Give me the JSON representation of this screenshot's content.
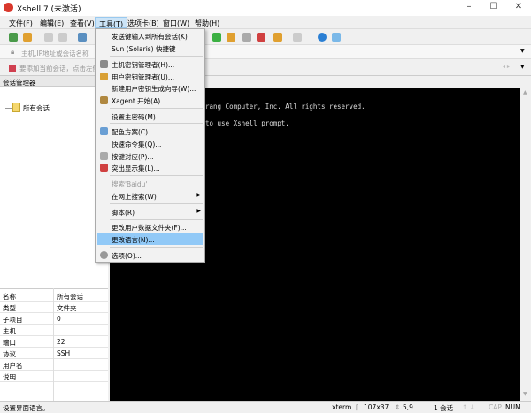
{
  "window": {
    "title": "Xshell 7 (未激活)",
    "minimize": "–",
    "maximize": "☐",
    "close": "✕"
  },
  "menubar": [
    "文件(F)",
    "编辑(E)",
    "查看(V)",
    "工具(T)",
    "选项卡(B)",
    "窗口(W)",
    "帮助(H)"
  ],
  "address_placeholder": "主机,IP地址或会话名称",
  "quickbar_text": "要添加当前会话，点击左侧",
  "session_manager": {
    "title": "会话管理器",
    "pin": "ᵖ",
    "tree_root": "所有会话"
  },
  "properties": [
    {
      "k": "名称",
      "v": "所有会话"
    },
    {
      "k": "类型",
      "v": "文件夹"
    },
    {
      "k": "子项目",
      "v": "0"
    },
    {
      "k": "主机",
      "v": ""
    },
    {
      "k": "端口",
      "v": "22"
    },
    {
      "k": "协议",
      "v": "SSH"
    },
    {
      "k": "用户名",
      "v": ""
    },
    {
      "k": "说明",
      "v": ""
    }
  ],
  "terminal": {
    "lines": [
      "rang Computer, Inc. All rights reserved.",
      "to use Xshell prompt."
    ]
  },
  "tools_menu": [
    {
      "label": "发送键输入到所有会话(K)"
    },
    {
      "label": "Sun (Solaris) 快捷键"
    },
    {
      "sep": true
    },
    {
      "label": "主机密钥管理者(H)...",
      "icon": "host-key-icon"
    },
    {
      "label": "用户密钥管理者(U)...",
      "icon": "user-key-icon"
    },
    {
      "label": "新建用户密钥生成向导(W)..."
    },
    {
      "label": "Xagent 开始(A)",
      "icon": "xagent-icon"
    },
    {
      "sep": true
    },
    {
      "label": "设置主密码(M)..."
    },
    {
      "sep": true
    },
    {
      "label": "配色方案(C)...",
      "icon": "color-scheme-icon"
    },
    {
      "label": "快速命令集(Q)..."
    },
    {
      "label": "按键对应(P)...",
      "icon": "keyboard-icon"
    },
    {
      "label": "突出显示集(L)...",
      "icon": "highlight-icon"
    },
    {
      "sep": true
    },
    {
      "label": "搜索'Baidu'",
      "disabled": true
    },
    {
      "label": "在网上搜索(W)",
      "submenu": true
    },
    {
      "sep": true
    },
    {
      "label": "脚本(R)",
      "submenu": true
    },
    {
      "sep": true
    },
    {
      "label": "更改用户数据文件夹(F)..."
    },
    {
      "label": "更改语言(N)...",
      "highlighted": true
    },
    {
      "sep": true
    },
    {
      "label": "选项(O)...",
      "icon": "gear-icon"
    }
  ],
  "statusbar": {
    "message": "设置界面语言。",
    "term": "xterm",
    "size": "107x37",
    "cursor": "5,9",
    "sessions": "1 会话",
    "cap": "CAP",
    "num": "NUM"
  },
  "colors": {
    "accent": "#d9382c",
    "highlight": "#91c9f7",
    "terminal_bg": "#000000"
  }
}
